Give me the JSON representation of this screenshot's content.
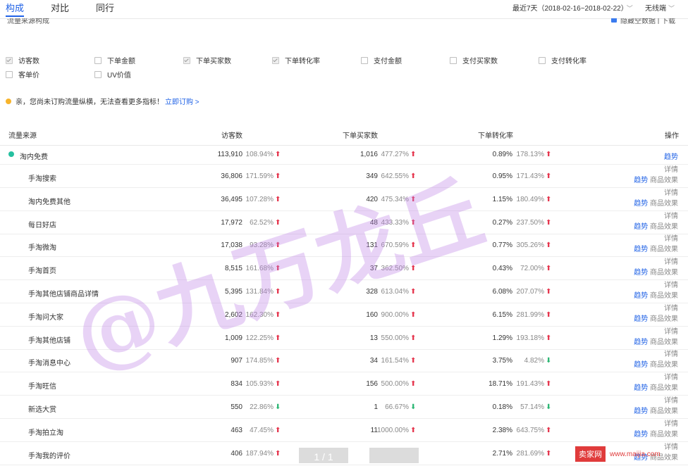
{
  "tabs": [
    "构成",
    "对比",
    "同行"
  ],
  "date_range": "最近7天（2018-02-16~2018-02-22）",
  "device": "无线端",
  "strip_left": "流量来源构成",
  "strip_right": "隐藏空数据 | 下载",
  "metrics": [
    {
      "label": "访客数",
      "checked": true
    },
    {
      "label": "下单金额",
      "checked": false
    },
    {
      "label": "下单买家数",
      "checked": true
    },
    {
      "label": "下单转化率",
      "checked": true
    },
    {
      "label": "支付金额",
      "checked": false
    },
    {
      "label": "支付买家数",
      "checked": false
    },
    {
      "label": "支付转化率",
      "checked": false
    },
    {
      "label": "客单价",
      "checked": false
    },
    {
      "label": "UV价值",
      "checked": false
    }
  ],
  "notice": {
    "text": "亲，您尚未订购流量纵横，无法查看更多指标！",
    "link": "立即订购 >"
  },
  "table": {
    "headers": {
      "source": "流量来源",
      "visitors": "访客数",
      "buyers": "下单买家数",
      "rate": "下单转化率",
      "ops": "操作"
    },
    "group": {
      "source": "淘内免费",
      "visitors": "113,910",
      "visitors_pct": "108.94%",
      "visitors_dir": "up",
      "buyers": "1,016",
      "buyers_pct": "477.27%",
      "buyers_dir": "up",
      "rate": "0.89%",
      "rate_pct": "178.13%",
      "rate_dir": "up",
      "op": "趋势"
    },
    "rows": [
      {
        "source": "手淘搜索",
        "visitors": "36,806",
        "visitors_pct": "171.59%",
        "visitors_dir": "up",
        "buyers": "349",
        "buyers_pct": "642.55%",
        "buyers_dir": "up",
        "rate": "0.95%",
        "rate_pct": "171.43%",
        "rate_dir": "up"
      },
      {
        "source": "淘内免费其他",
        "visitors": "36,495",
        "visitors_pct": "107.28%",
        "visitors_dir": "up",
        "buyers": "420",
        "buyers_pct": "475.34%",
        "buyers_dir": "up",
        "rate": "1.15%",
        "rate_pct": "180.49%",
        "rate_dir": "up"
      },
      {
        "source": "每日好店",
        "visitors": "17,972",
        "visitors_pct": "62.52%",
        "visitors_dir": "up",
        "buyers": "48",
        "buyers_pct": "433.33%",
        "buyers_dir": "up",
        "rate": "0.27%",
        "rate_pct": "237.50%",
        "rate_dir": "up"
      },
      {
        "source": "手淘微淘",
        "visitors": "17,038",
        "visitors_pct": "93.28%",
        "visitors_dir": "up",
        "buyers": "131",
        "buyers_pct": "670.59%",
        "buyers_dir": "up",
        "rate": "0.77%",
        "rate_pct": "305.26%",
        "rate_dir": "up"
      },
      {
        "source": "手淘首页",
        "visitors": "8,515",
        "visitors_pct": "161.68%",
        "visitors_dir": "up",
        "buyers": "37",
        "buyers_pct": "362.50%",
        "buyers_dir": "up",
        "rate": "0.43%",
        "rate_pct": "72.00%",
        "rate_dir": "up"
      },
      {
        "source": "手淘其他店铺商品详情",
        "visitors": "5,395",
        "visitors_pct": "131.84%",
        "visitors_dir": "up",
        "buyers": "328",
        "buyers_pct": "613.04%",
        "buyers_dir": "up",
        "rate": "6.08%",
        "rate_pct": "207.07%",
        "rate_dir": "up"
      },
      {
        "source": "手淘问大家",
        "visitors": "2,602",
        "visitors_pct": "162.30%",
        "visitors_dir": "up",
        "buyers": "160",
        "buyers_pct": "900.00%",
        "buyers_dir": "up",
        "rate": "6.15%",
        "rate_pct": "281.99%",
        "rate_dir": "up"
      },
      {
        "source": "手淘其他店铺",
        "visitors": "1,009",
        "visitors_pct": "122.25%",
        "visitors_dir": "up",
        "buyers": "13",
        "buyers_pct": "550.00%",
        "buyers_dir": "up",
        "rate": "1.29%",
        "rate_pct": "193.18%",
        "rate_dir": "up"
      },
      {
        "source": "手淘消息中心",
        "visitors": "907",
        "visitors_pct": "174.85%",
        "visitors_dir": "up",
        "buyers": "34",
        "buyers_pct": "161.54%",
        "buyers_dir": "up",
        "rate": "3.75%",
        "rate_pct": "4.82%",
        "rate_dir": "down"
      },
      {
        "source": "手淘旺信",
        "visitors": "834",
        "visitors_pct": "105.93%",
        "visitors_dir": "up",
        "buyers": "156",
        "buyers_pct": "500.00%",
        "buyers_dir": "up",
        "rate": "18.71%",
        "rate_pct": "191.43%",
        "rate_dir": "up"
      },
      {
        "source": "新选大赏",
        "visitors": "550",
        "visitors_pct": "22.86%",
        "visitors_dir": "down",
        "buyers": "1",
        "buyers_pct": "66.67%",
        "buyers_dir": "down",
        "rate": "0.18%",
        "rate_pct": "57.14%",
        "rate_dir": "down"
      },
      {
        "source": "手淘拍立淘",
        "visitors": "463",
        "visitors_pct": "47.45%",
        "visitors_dir": "up",
        "buyers": "11",
        "buyers_pct": "1000.00%",
        "buyers_dir": "up",
        "rate": "2.38%",
        "rate_pct": "643.75%",
        "rate_dir": "up"
      },
      {
        "source": "手淘我的评价",
        "visitors": "406",
        "visitors_pct": "187.94%",
        "visitors_dir": "up",
        "buyers": "11",
        "buyers_pct": "1000.00%",
        "buyers_dir": "up",
        "rate": "2.71%",
        "rate_pct": "281.69%",
        "rate_dir": "up"
      }
    ],
    "op_labels": {
      "detail": "详情",
      "trend": "趋势",
      "effect": "商品效果"
    }
  },
  "watermark": "@九万龙丘",
  "pager": "1 / 1",
  "site": {
    "name": "卖家网",
    "url": "www.maijia.com"
  }
}
